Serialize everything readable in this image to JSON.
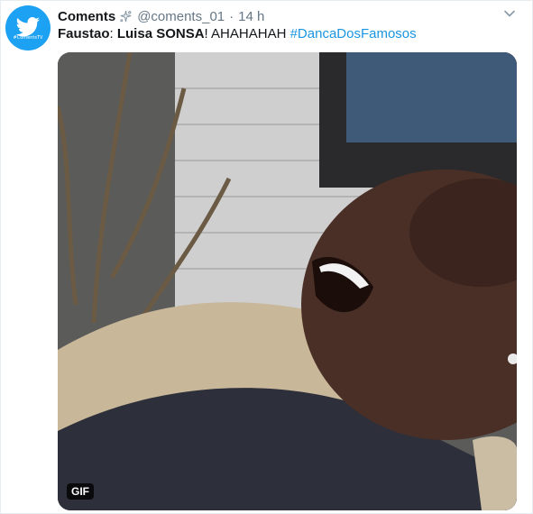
{
  "tweet": {
    "author_name": "Coments",
    "author_handle": "@coments_01",
    "separator": "·",
    "time": "14 h",
    "avatar_label": "#ComentsTV",
    "text_bold_1": "Faustao",
    "text_plain_1": ": ",
    "text_bold_2": "Luisa SONSA",
    "text_plain_2": "! AHAHAHAH ",
    "hashtag": "#DancaDosFamosos",
    "media_badge": "GIF"
  },
  "colors": {
    "brand_blue": "#1da1f2",
    "hashtag_blue": "#1b95e0",
    "text": "#14171a",
    "secondary_text": "#657786"
  },
  "icons": {
    "avatar": "twitter-bird-icon",
    "badge": "sparkle-badge-icon",
    "menu": "chevron-down-icon"
  }
}
